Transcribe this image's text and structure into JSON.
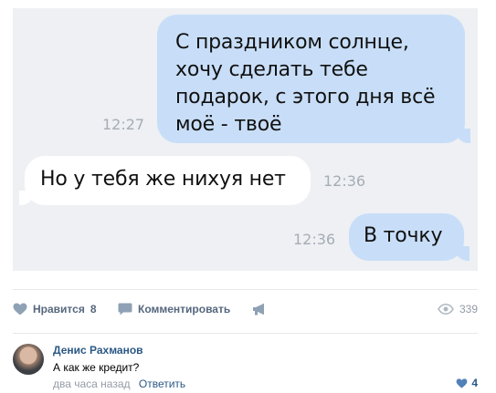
{
  "messages": [
    {
      "direction": "outgoing",
      "text": "С праздником солнце, хочу сделать тебе подарок, с этого дня всё моё - твоё",
      "time": "12:27"
    },
    {
      "direction": "incoming",
      "text": "Но у тебя же нихуя нет",
      "time": "12:36"
    },
    {
      "direction": "outgoing",
      "text": "В точку",
      "time": "12:36"
    }
  ],
  "post_actions": {
    "like_label": "Нравится",
    "like_count": "8",
    "comment_label": "Комментировать",
    "views_count": "339"
  },
  "comment": {
    "author": "Денис Рахманов",
    "text": "А как же кредит?",
    "time": "два часа назад",
    "reply_label": "Ответить",
    "likes": "4"
  },
  "icons": {
    "like": "heart-icon",
    "comment": "speech-bubble-icon",
    "share": "megaphone-icon",
    "views": "eye-icon",
    "comment_like": "heart-icon"
  },
  "colors": {
    "outgoing_bubble": "#c8def8",
    "incoming_bubble": "#ffffff",
    "chat_background": "#eef0f3",
    "link": "#2a5885",
    "muted": "#939ba6"
  }
}
